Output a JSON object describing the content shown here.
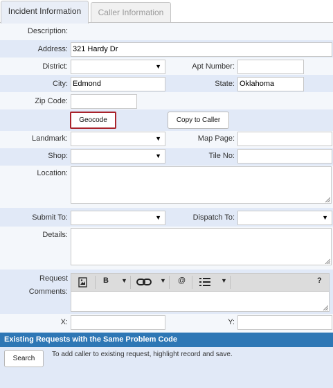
{
  "tabs": [
    {
      "label": "Incident Information",
      "active": true
    },
    {
      "label": "Caller Information",
      "active": false
    }
  ],
  "form": {
    "description_label": "Description:",
    "address_label": "Address:",
    "address_value": "321 Hardy Dr",
    "district_label": "District:",
    "district_value": "",
    "apt_label": "Apt Number:",
    "apt_value": "",
    "city_label": "City:",
    "city_value": "Edmond",
    "state_label": "State:",
    "state_value": "Oklahoma",
    "zip_label": "Zip Code:",
    "zip_value": "",
    "geocode_button": "Geocode",
    "copy_button": "Copy to Caller",
    "landmark_label": "Landmark:",
    "landmark_value": "",
    "mappage_label": "Map Page:",
    "mappage_value": "",
    "shop_label": "Shop:",
    "shop_value": "",
    "tileno_label": "Tile No:",
    "tileno_value": "",
    "location_label": "Location:",
    "submitto_label": "Submit To:",
    "submitto_value": "",
    "dispatchto_label": "Dispatch To:",
    "dispatchto_value": "",
    "details_label": "Details:",
    "request_label": "Request",
    "comments_label": "Comments:",
    "x_label": "X:",
    "x_value": "",
    "y_label": "Y:",
    "y_value": ""
  },
  "toolbar": {
    "bold": "B",
    "mention": "@",
    "help": "?"
  },
  "existing": {
    "title": "Existing Requests with the Same Problem Code",
    "search_button": "Search",
    "hint": "To add caller to existing request, highlight record and save."
  },
  "icons": {
    "dropdown": "dropdown-caret-icon",
    "image": "image-icon",
    "link": "link-icon",
    "list": "bulleted-list-icon"
  },
  "colors": {
    "section_header": "#2e77b5",
    "row_alt": "#e1e9f7",
    "row_plain": "#f4f7fb",
    "geocode_border": "#a9232b"
  }
}
